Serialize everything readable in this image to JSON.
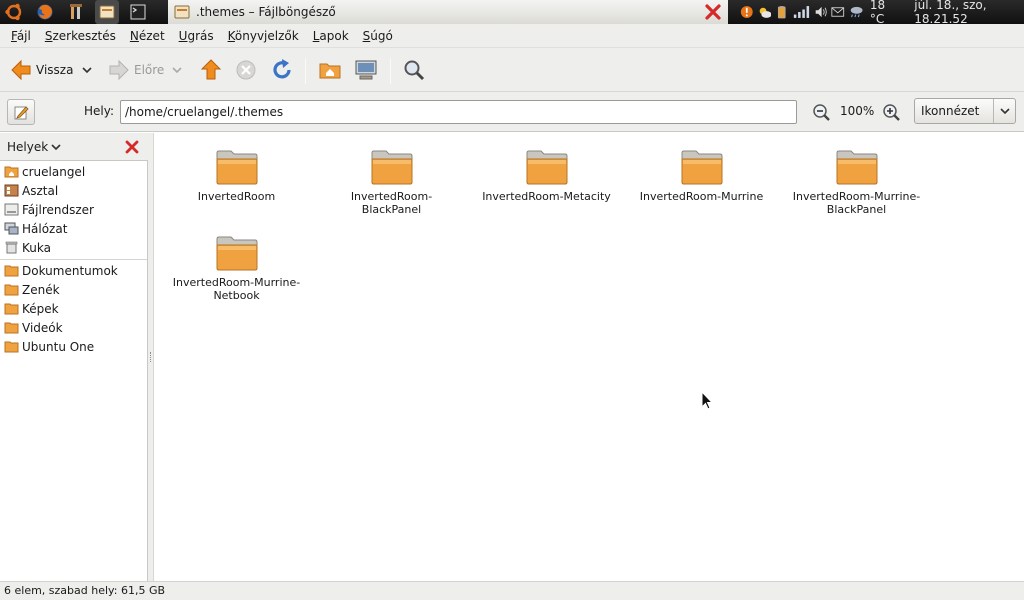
{
  "panel": {
    "launchers": [
      "ubuntu-logo-icon",
      "firefox-icon",
      "tools-icon",
      "file-manager-icon",
      "terminal-icon"
    ],
    "task_title": ".themes – Fájlböngésző",
    "temperature": "18 °C",
    "clock": "júl. 18., szo, 18.21.52"
  },
  "menubar": {
    "items": [
      {
        "pre": "",
        "u": "F",
        "post": "ájl"
      },
      {
        "pre": "",
        "u": "S",
        "post": "zerkesztés"
      },
      {
        "pre": "",
        "u": "N",
        "post": "ézet"
      },
      {
        "pre": "",
        "u": "U",
        "post": "grás"
      },
      {
        "pre": "",
        "u": "K",
        "post": "önyvjelzők"
      },
      {
        "pre": "",
        "u": "L",
        "post": "apok"
      },
      {
        "pre": "",
        "u": "S",
        "post": "úgó"
      }
    ]
  },
  "toolbar": {
    "back_label": "Vissza",
    "forward_label": "Előre"
  },
  "location": {
    "label": "Hely:",
    "path": "/home/cruelangel/.themes",
    "zoom": "100%",
    "view": "Ikonnézet"
  },
  "sidebar": {
    "title": "Helyek",
    "places": [
      {
        "label": "cruelangel",
        "icon": "home-folder-icon"
      },
      {
        "label": "Asztal",
        "icon": "desktop-icon"
      },
      {
        "label": "Fájlrendszer",
        "icon": "filesystem-icon"
      },
      {
        "label": "Hálózat",
        "icon": "network-icon"
      },
      {
        "label": "Kuka",
        "icon": "trash-icon"
      }
    ],
    "bookmarks": [
      {
        "label": "Dokumentumok",
        "icon": "folder-icon"
      },
      {
        "label": "Zenék",
        "icon": "folder-icon"
      },
      {
        "label": "Képek",
        "icon": "folder-icon"
      },
      {
        "label": "Videók",
        "icon": "folder-icon"
      },
      {
        "label": "Ubuntu One",
        "icon": "folder-icon"
      }
    ]
  },
  "files": [
    {
      "line1": "InvertedRoom",
      "line2": ""
    },
    {
      "line1": "InvertedRoom-",
      "line2": "BlackPanel"
    },
    {
      "line1": "InvertedRoom-Metacity",
      "line2": ""
    },
    {
      "line1": "InvertedRoom-Murrine",
      "line2": ""
    },
    {
      "line1": "InvertedRoom-Murrine-",
      "line2": "BlackPanel"
    },
    {
      "line1": "InvertedRoom-Murrine-",
      "line2": "Netbook"
    }
  ],
  "status": "6 elem, szabad hely: 61,5 GB",
  "colors": {
    "folder_orange": "#f0a240",
    "close_red": "#d42a2a",
    "arrow_orange": "#f08b1d",
    "reload_blue": "#3a73c8"
  }
}
